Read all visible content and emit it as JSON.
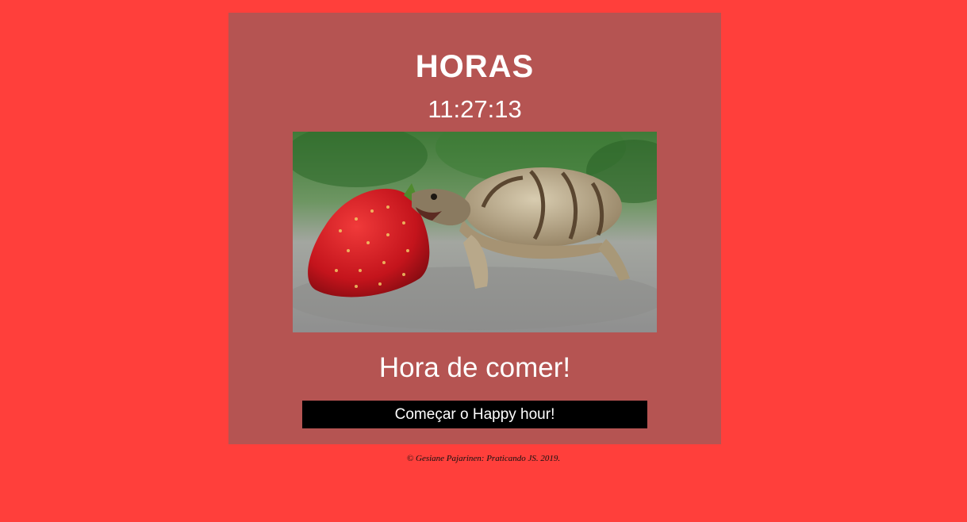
{
  "header": {
    "title": "HORAS"
  },
  "clock": {
    "time": "11:27:13"
  },
  "image": {
    "icon": "tortoise-eating-strawberry-photo"
  },
  "message": {
    "text": "Hora de comer!"
  },
  "button": {
    "label": "Começar o Happy hour!"
  },
  "footer": {
    "text": "© Gesiane Pajarinen: Praticando JS. 2019."
  },
  "colors": {
    "page_background": "#ff3f3b",
    "card_background": "#b55452",
    "button_background": "#000000",
    "text": "#ffffff"
  }
}
